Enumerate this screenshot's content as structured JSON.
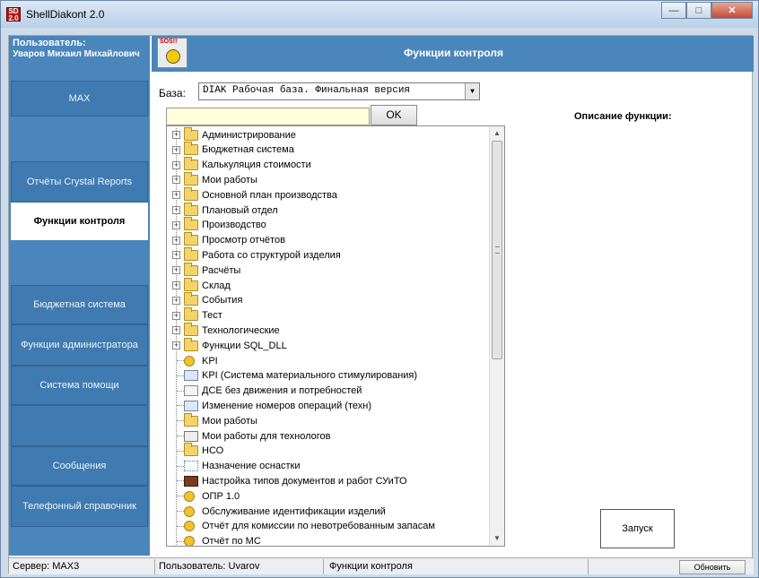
{
  "window": {
    "title": "ShellDiakont 2.0",
    "icon_text": "SD 2.0"
  },
  "sidebar": {
    "user_label": "Пользователь:",
    "user_name": "Уваров Михаил Михайлович",
    "buttons": [
      "MAX",
      "Отчёты Crystal Reports",
      "Функции контроля",
      "Бюджетная система",
      "Функции администратора",
      "Система помощи",
      "Сообщения",
      "Телефонный справочник"
    ]
  },
  "header": {
    "title": "Функции контроля",
    "sos": "SOS!!"
  },
  "base": {
    "label": "База:",
    "value": "DIAK  Рабочая база. Финальная версия"
  },
  "search": {
    "value": "",
    "ok": "OK"
  },
  "description_label": "Описание функции:",
  "tree": {
    "groups": [
      "Администрирование",
      "Бюджетная система",
      "Калькуляция стоимости",
      "Мои работы",
      "Основной план производства",
      "Плановый отдел",
      "Производство",
      "Просмотр отчётов",
      "Работа со структурой изделия",
      "Расчёты",
      "Склад",
      "События",
      "Тест",
      "Технологические",
      "Функции SQL_DLL"
    ],
    "items": [
      {
        "label": "KPI",
        "icon": "key-icon"
      },
      {
        "label": "KPI (Система материального стимулирования)",
        "icon": "form-icon"
      },
      {
        "label": "ДСЕ без движения и потребностей",
        "icon": "edit-icon"
      },
      {
        "label": "Изменение номеров операций (техн)",
        "icon": "form-icon"
      },
      {
        "label": "Мои работы",
        "icon": "folder-icon"
      },
      {
        "label": "Мои работы для технологов",
        "icon": "doc-icon"
      },
      {
        "label": "НСО",
        "icon": "folder-icon"
      },
      {
        "label": "Назначение оснастки",
        "icon": "network-icon"
      },
      {
        "label": "Настройка типов документов и работ СУиТО",
        "icon": "book-icon"
      },
      {
        "label": "ОПР 1.0",
        "icon": "key-icon"
      },
      {
        "label": "Обслуживание идентификации изделий",
        "icon": "key-icon"
      },
      {
        "label": "Отчёт для комиссии по невотребованным запасам",
        "icon": "key-icon"
      },
      {
        "label": "Отчёт по МС",
        "icon": "key-icon"
      }
    ]
  },
  "run_button": "Запуск",
  "status": {
    "server": "Сервер:   MAX3",
    "user": "Пользователь:   Uvarov",
    "mode": "Функции контроля",
    "refresh": "Обновить"
  },
  "colors": {
    "sidebar": "#4a86bb",
    "header": "#4a86bb",
    "search_bg": "#ffffd9"
  }
}
